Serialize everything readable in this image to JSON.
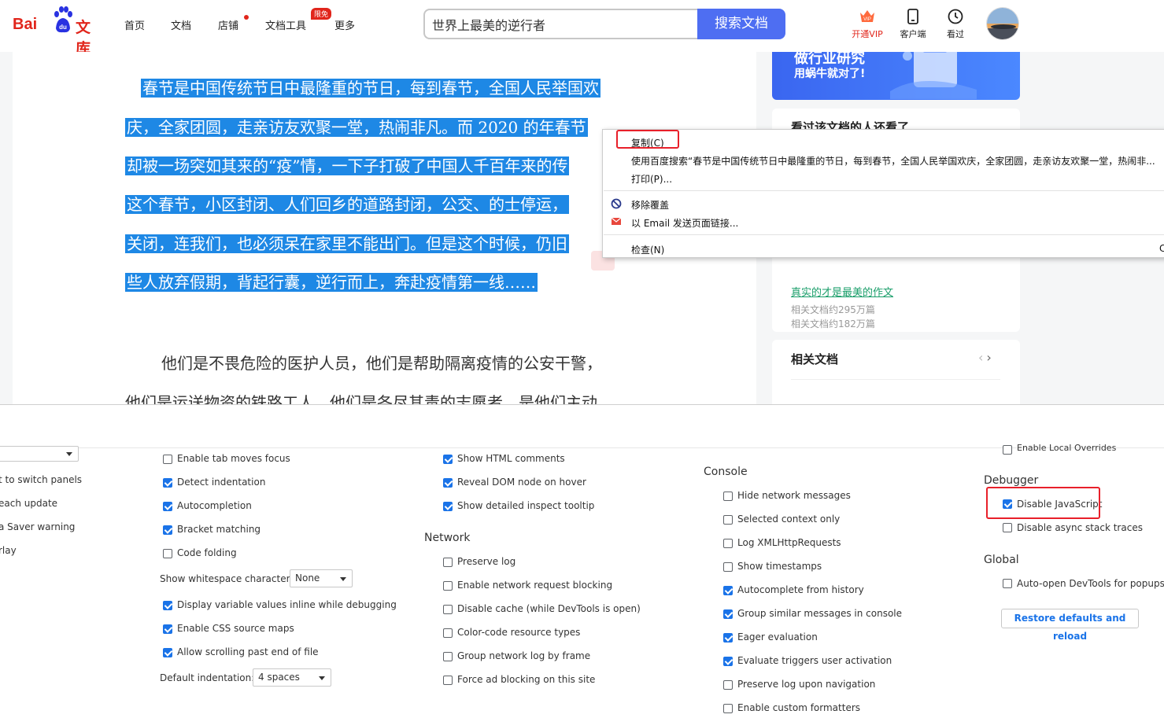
{
  "header": {
    "logo_text": "Bai",
    "logo_du": "du",
    "logo_wenku": "文库",
    "nav": [
      "首页",
      "文档",
      "店铺",
      "文档工具",
      "更多"
    ],
    "tools_badge": "限免",
    "search_value": "世界上最美的逆行者",
    "search_button": "搜索文档",
    "vip_label": "开通VIP",
    "vip_icon_text": "VIP",
    "client_label": "客户端",
    "history_label": "看过",
    "accent": "#4e6ef2",
    "brand_red": "#e1251b"
  },
  "doc": {
    "selected_lines": [
      "春节是中国传统节日中最隆重的节日，每到春节，全国人民举国欢",
      "庆，全家团圆，走亲访友欢聚一堂，热闹非凡。而 2020 的年春节",
      "却被一场突如其来的“疫”情，一下子打破了中国人千百年来的传",
      "这个春节，小区封闭、人们回乡的道路封闭，公交、的士停运，",
      "关闭，连我们，也必须呆在家里不能出门。但是这个时候，仍旧",
      "些人放弃假期，背起行囊，逆行而上，奔赴疫情第一线……"
    ],
    "paragraph2_line1": "他们是不畏危险的医护人员，他们是帮助隔离疫情的公安干警，",
    "paragraph2_line2": "他们是运送物资的铁路工人，他们是各尽其责的志愿者，是他们主动",
    "selection_color": "#1e88e5"
  },
  "sidebar": {
    "ad_line1": "做行业研究",
    "ad_line2": "用蜗牛就对了!",
    "also_viewed_title": "看过该文档的人还看了",
    "related_count_1": "相关文档约182万篇",
    "related_link_2": "真实的才是最美的作文",
    "related_count_2": "相关文档约295万篇",
    "related_docs_title": "相关文档",
    "arrow_prev": "‹",
    "arrow_next": "›"
  },
  "context_menu": {
    "copy": "复制(C)",
    "baidu_search": "使用百度搜索“春节是中国传统节日中最隆重的节日，每到春节，全国人民举国欢庆，全家团圆，走亲访友欢聚一堂，热闹非...",
    "print": "打印(P)...",
    "remove_overlay": "移除覆盖",
    "email_link": "以 Email 发送页面链接...",
    "inspect": "检查(N)",
    "inspect_shortcut": "C"
  },
  "devtools": {
    "col1": {
      "select_value": "",
      "items": [
        "t to switch panels",
        "each update",
        "a Saver warning",
        "rlay"
      ]
    },
    "sources": {
      "checkboxes": [
        {
          "label": "Enable tab moves focus",
          "checked": false
        },
        {
          "label": "Detect indentation",
          "checked": true
        },
        {
          "label": "Autocompletion",
          "checked": true
        },
        {
          "label": "Bracket matching",
          "checked": true
        },
        {
          "label": "Code folding",
          "checked": false
        }
      ],
      "whitespace_label": "Show whitespace characters:",
      "whitespace_value": "None",
      "checkboxes2": [
        {
          "label": "Display variable values inline while debugging",
          "checked": true
        },
        {
          "label": "Enable CSS source maps",
          "checked": true
        },
        {
          "label": "Allow scrolling past end of file",
          "checked": true
        }
      ],
      "indent_label": "Default indentation:",
      "indent_value": "4 spaces"
    },
    "elements": {
      "checkboxes": [
        {
          "label": "Show HTML comments",
          "checked": true
        },
        {
          "label": "Reveal DOM node on hover",
          "checked": true
        },
        {
          "label": "Show detailed inspect tooltip",
          "checked": true
        }
      ]
    },
    "network": {
      "title": "Network",
      "checkboxes": [
        {
          "label": "Preserve log",
          "checked": false
        },
        {
          "label": "Enable network request blocking",
          "checked": false
        },
        {
          "label": "Disable cache (while DevTools is open)",
          "checked": false
        },
        {
          "label": "Color-code resource types",
          "checked": false
        },
        {
          "label": "Group network log by frame",
          "checked": false
        },
        {
          "label": "Force ad blocking on this site",
          "checked": false
        }
      ]
    },
    "console": {
      "title": "Console",
      "checkboxes": [
        {
          "label": "Hide network messages",
          "checked": false
        },
        {
          "label": "Selected context only",
          "checked": false
        },
        {
          "label": "Log XMLHttpRequests",
          "checked": false
        },
        {
          "label": "Show timestamps",
          "checked": false
        },
        {
          "label": "Autocomplete from history",
          "checked": true
        },
        {
          "label": "Group similar messages in console",
          "checked": true
        },
        {
          "label": "Eager evaluation",
          "checked": true
        },
        {
          "label": "Evaluate triggers user activation",
          "checked": true
        },
        {
          "label": "Preserve log upon navigation",
          "checked": false
        },
        {
          "label": "Enable custom formatters",
          "checked": false
        }
      ]
    },
    "right": {
      "local_overrides": "Enable Local Overrides",
      "debugger_title": "Debugger",
      "disable_js": "Disable JavaScript",
      "disable_js_checked": true,
      "disable_async": "Disable async stack traces",
      "global_title": "Global",
      "auto_open": "Auto-open DevTools for popups",
      "restore": "Restore defaults and reload"
    },
    "checkbox_color": "#1a73e8",
    "highlight_color": "#e8202a"
  }
}
